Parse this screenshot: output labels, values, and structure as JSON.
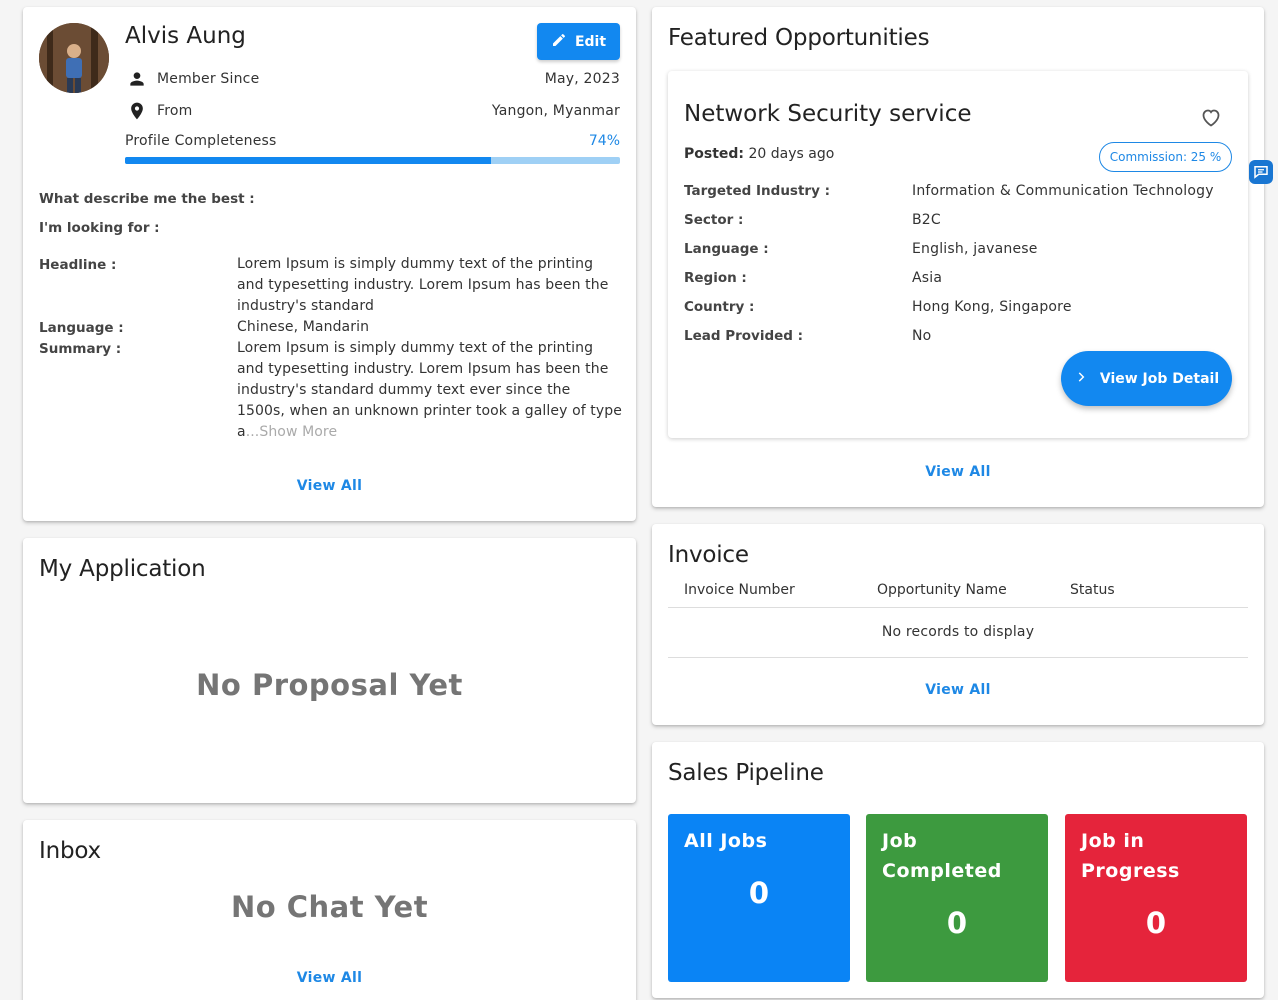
{
  "profile": {
    "name": "Alvis Aung",
    "edit_label": "Edit",
    "member_since_label": "Member Since",
    "member_since_value": "May, 2023",
    "from_label": "From",
    "from_value": "Yangon, Myanmar",
    "completeness_label": "Profile Completeness",
    "completeness_value": "74%",
    "completeness_fraction": 0.74,
    "describe_label": "What describe me the best :",
    "looking_label": "I'm looking for :",
    "headline_label": "Headline :",
    "headline_value": "Lorem Ipsum is simply dummy text of the printing and typesetting industry. Lorem Ipsum has been the industry's standard",
    "language_label": "Language :",
    "language_value": "Chinese, Mandarin",
    "summary_label": "Summary :",
    "summary_value": "Lorem Ipsum is simply dummy text of the printing and typesetting industry. Lorem Ipsum has been the industry's standard dummy text ever since the 1500s, when an unknown printer took a galley of type a",
    "show_more": "...Show More",
    "view_all": "View All"
  },
  "featured": {
    "title": "Featured Opportunities",
    "opportunity_title": "Network Security service",
    "posted_label": "Posted:",
    "posted_value": "20 days ago",
    "commission": "Commission: 25 %",
    "fields": [
      {
        "label": "Targeted Industry :",
        "value": "Information & Communication Technology"
      },
      {
        "label": "Sector :",
        "value": "B2C"
      },
      {
        "label": "Language :",
        "value": "English, javanese"
      },
      {
        "label": "Region :",
        "value": "Asia"
      },
      {
        "label": "Country :",
        "value": "Hong Kong, Singapore"
      },
      {
        "label": "Lead Provided :",
        "value": "No"
      }
    ],
    "job_detail_label": "View Job Detail",
    "view_all": "View All"
  },
  "application": {
    "title": "My Application",
    "empty": "No Proposal Yet"
  },
  "inbox": {
    "title": "Inbox",
    "empty": "No Chat Yet",
    "view_all": "View All"
  },
  "invoice": {
    "title": "Invoice",
    "columns": [
      "Invoice Number",
      "Opportunity Name",
      "Status"
    ],
    "empty": "No records to display",
    "view_all": "View All"
  },
  "pipeline": {
    "title": "Sales Pipeline",
    "tiles": [
      {
        "title": "All Jobs",
        "count": "0",
        "color": "#0a84f5"
      },
      {
        "title": "Job Completed",
        "count": "0",
        "color": "#3d9a3f"
      },
      {
        "title": "Job in Progress",
        "count": "0",
        "color": "#e5243b"
      }
    ]
  },
  "icons": {
    "edit": "pencil-icon",
    "member": "person-icon",
    "from": "location-pin-icon",
    "favorite": "heart-outline-icon",
    "job_detail": "chevron-right-icon",
    "floating": "chat-bubble-icon"
  },
  "colors": {
    "primary": "#1288f0",
    "link": "#1e88e5"
  }
}
